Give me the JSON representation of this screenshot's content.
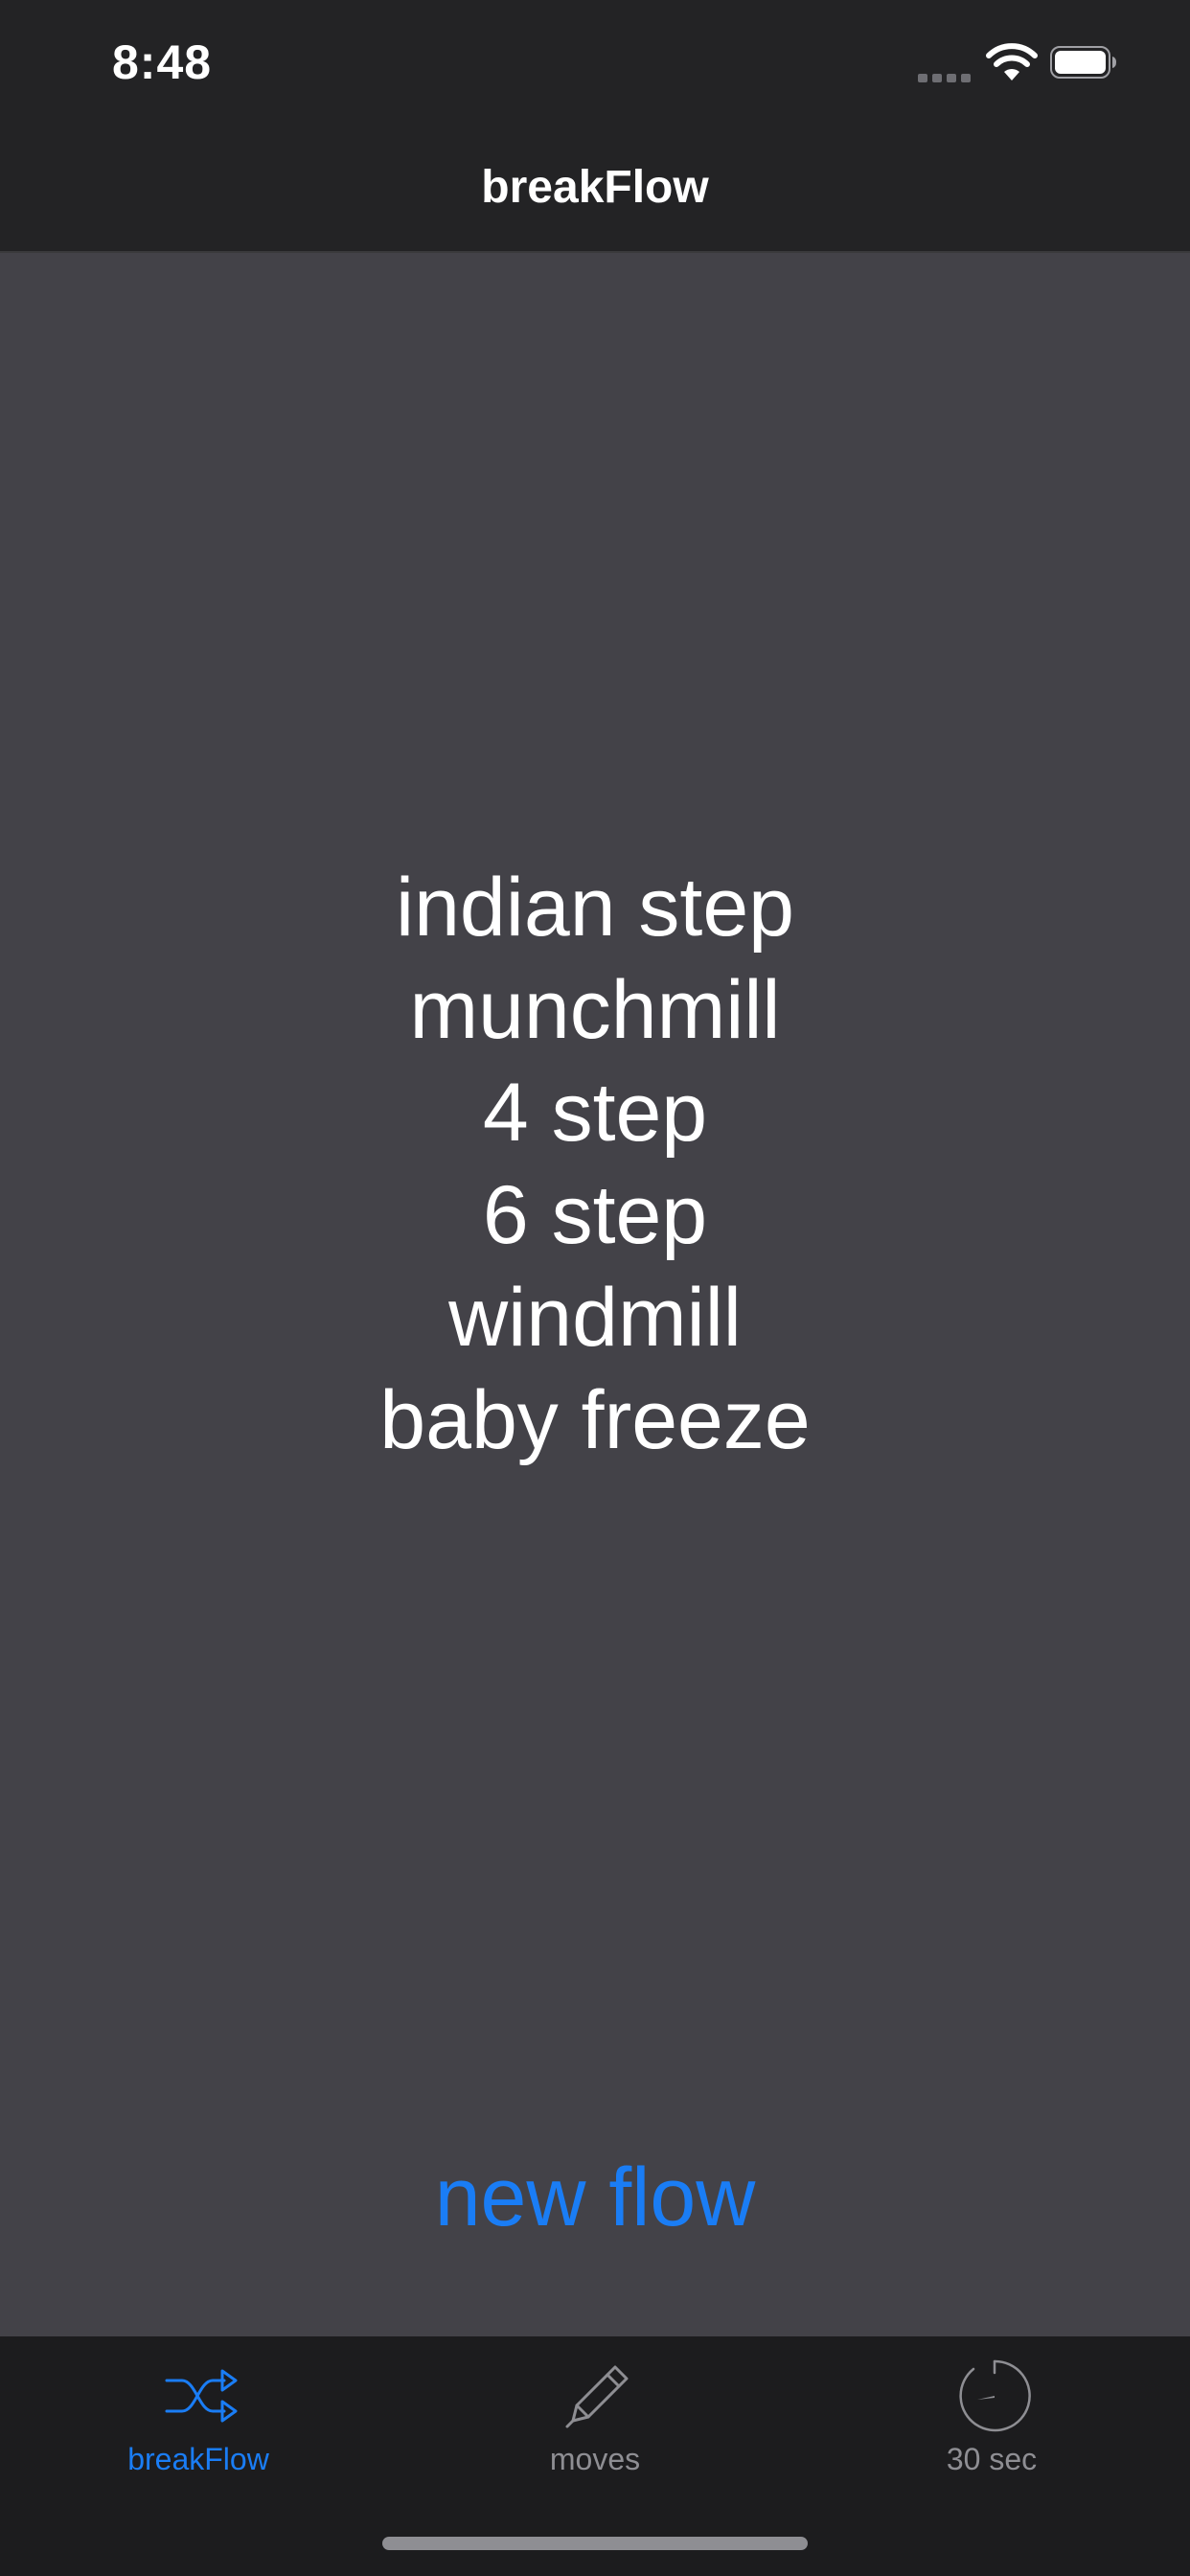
{
  "status_bar": {
    "time": "8:48"
  },
  "nav": {
    "title": "breakFlow"
  },
  "flow": {
    "moves": [
      "indian step",
      "munchmill",
      "4 step",
      "6 step",
      "windmill",
      "baby freeze"
    ]
  },
  "actions": {
    "new_flow": "new flow"
  },
  "tab_bar": {
    "tabs": [
      {
        "label": "breakFlow",
        "icon": "shuffle-icon",
        "selected": true
      },
      {
        "label": "moves",
        "icon": "pencil-icon",
        "selected": false
      },
      {
        "label": "30 sec",
        "icon": "timer-icon",
        "selected": false
      }
    ]
  },
  "colors": {
    "accent": "#1a7df5",
    "background": "#434248",
    "bar": "#232325",
    "tab_inactive": "#8e8e93"
  }
}
